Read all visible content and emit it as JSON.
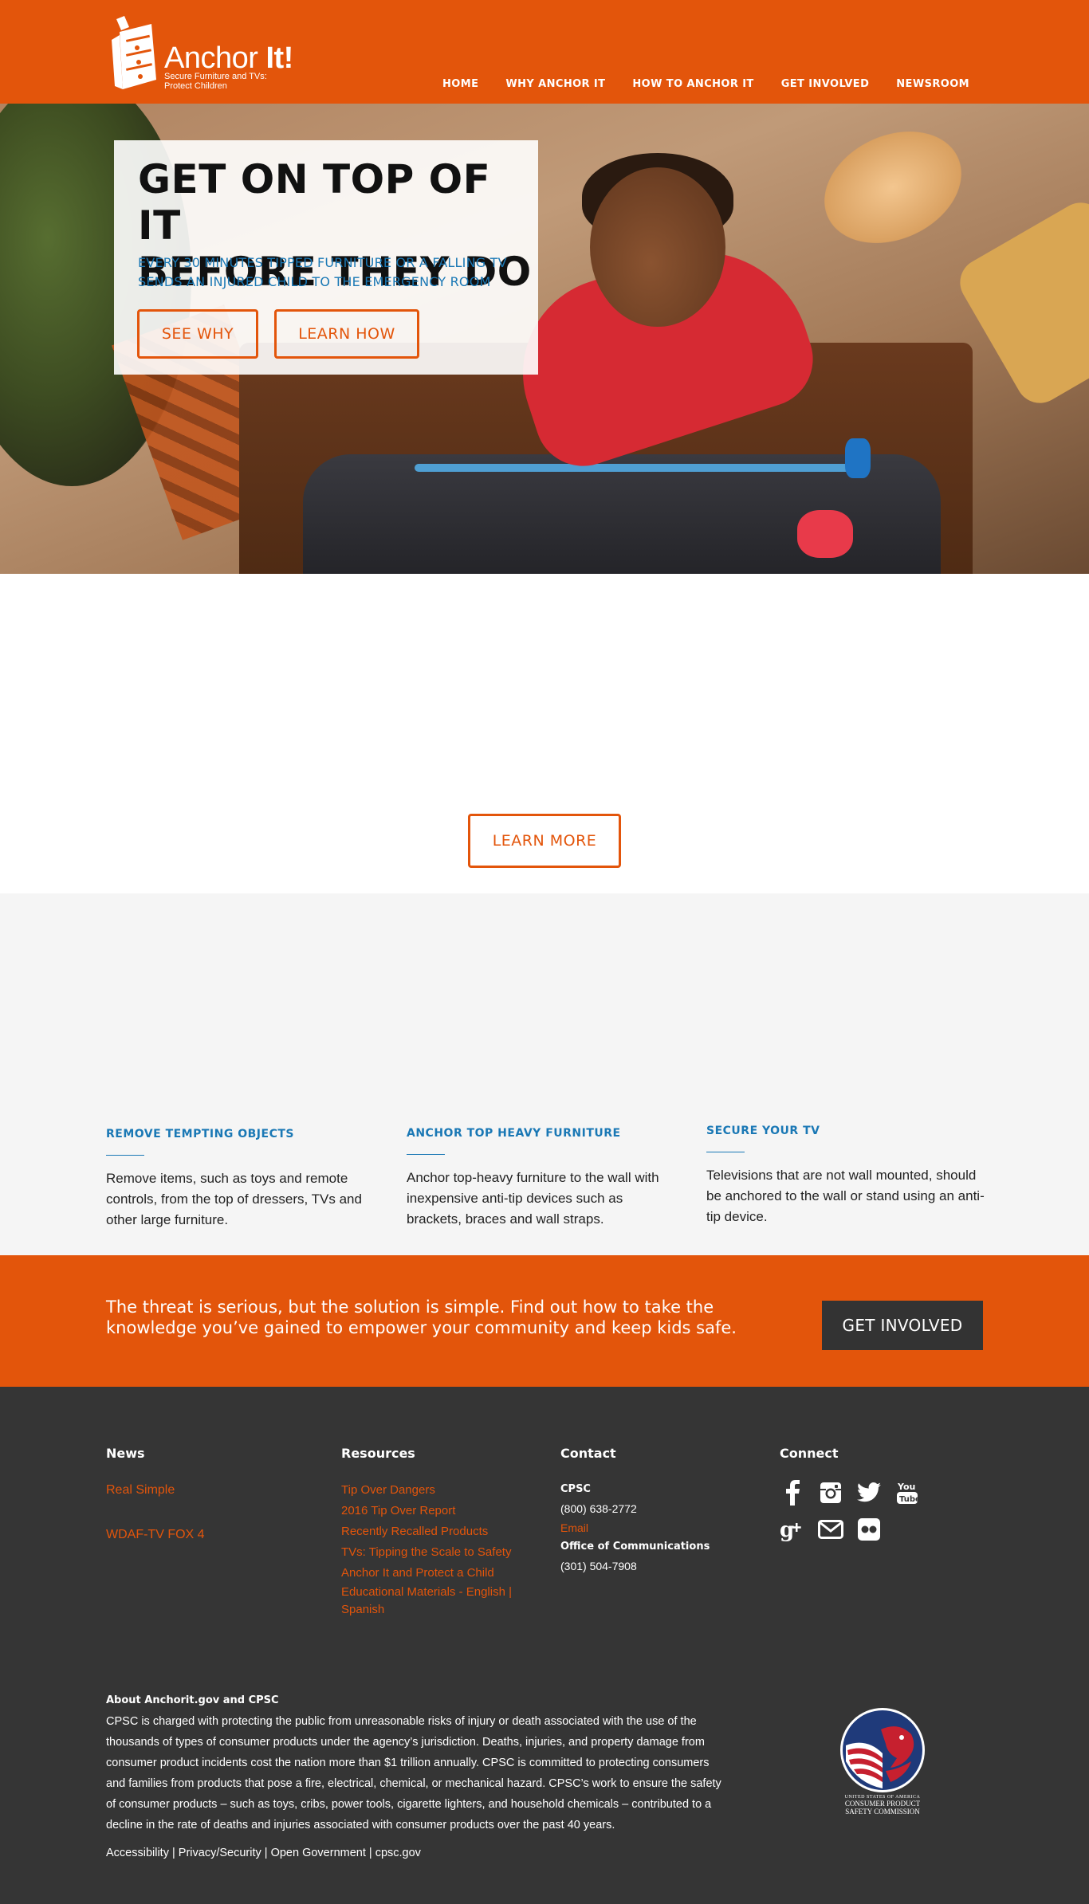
{
  "brand": {
    "name_part1": "Anchor ",
    "name_part2": "It!",
    "tagline_line1": "Secure Furniture and TVs:",
    "tagline_line2": "Protect Children",
    "accent": "#e3550b",
    "blue": "#1a78b5",
    "dark": "#353535"
  },
  "nav": {
    "items": [
      "HOME",
      "WHY ANCHOR IT",
      "HOW TO ANCHOR IT",
      "GET INVOLVED",
      "NEWSROOM"
    ]
  },
  "hero": {
    "title_line1": "GET ON TOP OF IT",
    "title_line2": "BEFORE THEY DO",
    "subtitle_line1": "EVERY 30 MINUTES TIPPED FURNITURE OR A FALLING TV",
    "subtitle_line2": "SENDS AN INJURED CHILD TO THE EMERGENCY ROOM",
    "btn_see_why": "SEE WHY",
    "btn_learn_how": "LEARN HOW"
  },
  "learn_more": {
    "label": "LEARN MORE"
  },
  "tips": [
    {
      "title": "REMOVE TEMPTING OBJECTS",
      "text": "Remove items, such as toys and remote controls, from the top of dressers, TVs and other large furniture."
    },
    {
      "title": "ANCHOR TOP HEAVY FURNITURE",
      "text": "Anchor top-heavy furniture to the wall with inexpensive anti-tip devices such as brackets, braces and wall straps."
    },
    {
      "title": "SECURE YOUR TV",
      "text": "Televisions that are not wall mounted, should be anchored to the wall or stand using an anti-tip device."
    }
  ],
  "cta": {
    "text_line1": "The threat is serious, but the solution is simple. Find out how to take the",
    "text_line2": "knowledge you’ve gained to empower your community and keep kids safe.",
    "button": "GET INVOLVED"
  },
  "footer": {
    "news": {
      "heading": "News",
      "links": [
        "Real Simple",
        "WDAF-TV FOX 4"
      ]
    },
    "resources": {
      "heading": "Resources",
      "links": [
        "Tip Over Dangers",
        "2016 Tip Over Report",
        "Recently Recalled Products",
        "TVs: Tipping the Scale to Safety",
        "Anchor It and Protect a Child",
        "Educational Materials - English |",
        "Spanish"
      ]
    },
    "contact": {
      "heading": "Contact",
      "org": "CPSC",
      "phone1": "(800) 638-2772",
      "email": "Email",
      "office": "Office of Communications",
      "phone2": "(301) 504-7908"
    },
    "connect": {
      "heading": "Connect",
      "icons": [
        "facebook-icon",
        "instagram-icon",
        "twitter-icon",
        "youtube-icon",
        "google-plus-icon",
        "email-icon",
        "flickr-icon"
      ]
    },
    "about": {
      "heading": "About Anchorit.gov and CPSC",
      "text": "CPSC is charged with protecting the public from unreasonable risks of injury or death associated with the use of the thousands of types of consumer products under the agency’s jurisdiction. Deaths, injuries, and property damage from consumer product incidents cost the nation more than $1 trillion annually. CPSC is committed to protecting consumers and families from products that pose a fire, electrical, chemical, or mechanical hazard. CPSC’s work to ensure the safety of consumer products – such as toys, cribs, power tools, cigarette lighters, and household chemicals – contributed to a decline in the rate of deaths and injuries associated with consumer products over the past 40 years."
    },
    "legal": {
      "accessibility": "Accessibility",
      "privacy": "Privacy/Security",
      "open_gov": "Open Government",
      "cpsc": "cpsc.gov",
      "sep": " | "
    },
    "seal": {
      "line1": "UNITED STATES OF AMERICA",
      "line2": "CONSUMER PRODUCT",
      "line3": "SAFETY COMMISSION"
    }
  }
}
